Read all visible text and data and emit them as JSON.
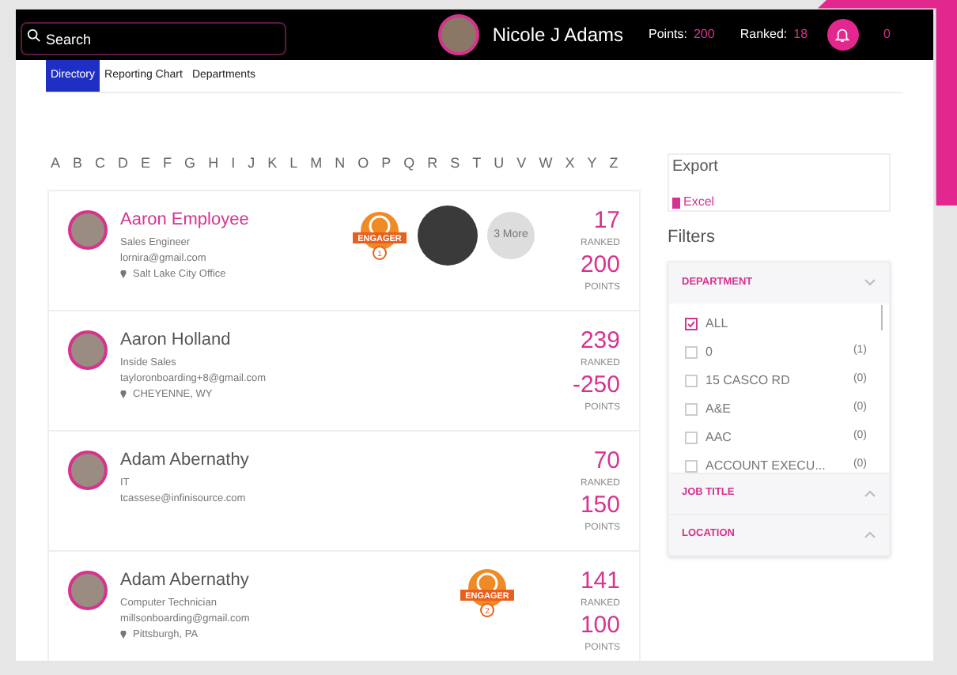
{
  "header": {
    "search": {
      "placeholder": "Search"
    },
    "user": {
      "name": "Nicole J Adams"
    },
    "points": {
      "label": "Points:",
      "value": "200"
    },
    "ranked": {
      "label": "Ranked:",
      "value": "18"
    },
    "notifications": {
      "count": "0"
    }
  },
  "tabs": [
    {
      "label": "Directory",
      "selected": true
    },
    {
      "label": "Reporting Chart",
      "selected": false
    },
    {
      "label": "Departments",
      "selected": false
    }
  ],
  "alphabet": [
    "A",
    "B",
    "C",
    "D",
    "E",
    "F",
    "G",
    "H",
    "I",
    "J",
    "K",
    "L",
    "M",
    "N",
    "O",
    "P",
    "Q",
    "R",
    "S",
    "T",
    "U",
    "V",
    "W",
    "X",
    "Y",
    "Z"
  ],
  "people": [
    {
      "name": "Aaron Employee",
      "selected": true,
      "title": "Sales Engineer",
      "email": "lornira@gmail.com",
      "location": "Salt Lake City Office",
      "badges": [
        {
          "kind": "badge",
          "label": "ENGAGER",
          "level": "1"
        },
        {
          "kind": "photo"
        },
        {
          "kind": "more",
          "label": "3 More"
        }
      ],
      "rank": "17",
      "rank_label": "RANKED",
      "points": "200",
      "points_label": "POINTS"
    },
    {
      "name": "Aaron Holland",
      "selected": false,
      "title": "Inside Sales",
      "email": "tayloronboarding+8@gmail.com",
      "location": "CHEYENNE, WY",
      "rank": "239",
      "rank_label": "RANKED",
      "points": "-250",
      "points_label": "POINTS"
    },
    {
      "name": "Adam Abernathy",
      "selected": false,
      "title": "IT",
      "email": "tcassese@infinisource.com",
      "rank": "70",
      "rank_label": "RANKED",
      "points": "150",
      "points_label": "POINTS"
    },
    {
      "name": "Adam Abernathy",
      "selected": false,
      "title": "Computer Technician",
      "email": "millsonboarding@gmail.com",
      "location": "Pittsburgh, PA",
      "badges": [
        {
          "kind": "badge",
          "label": "ENGAGER",
          "level": "2"
        }
      ],
      "rank": "141",
      "rank_label": "RANKED",
      "points": "100",
      "points_label": "POINTS"
    }
  ],
  "export": {
    "title": "Export",
    "link": "Excel"
  },
  "filters": {
    "title": "Filters",
    "groups": [
      {
        "label": "DEPARTMENT",
        "expanded": true,
        "options": [
          {
            "label": "ALL",
            "checked": true
          },
          {
            "label": "0",
            "checked": false,
            "count": "(1)"
          },
          {
            "label": "15 CASCO RD",
            "checked": false,
            "count": "(0)"
          },
          {
            "label": "A&E",
            "checked": false,
            "count": "(0)"
          },
          {
            "label": "AAC",
            "checked": false,
            "count": "(0)"
          },
          {
            "label": "ACCOUNT EXECU...",
            "checked": false,
            "count": "(0)"
          }
        ]
      },
      {
        "label": "JOB TITLE",
        "expanded": false
      },
      {
        "label": "LOCATION",
        "expanded": false
      }
    ]
  }
}
